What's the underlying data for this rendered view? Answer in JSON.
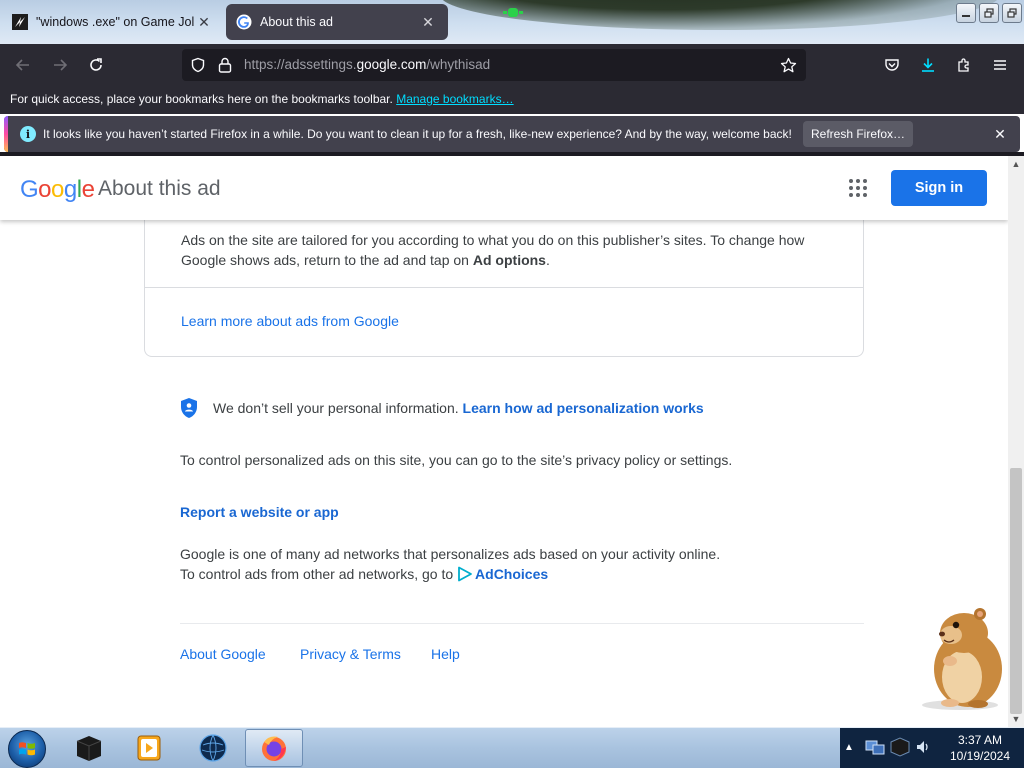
{
  "browser": {
    "tabs": [
      {
        "title": "\"windows .exe\" on Game Jolt",
        "active": false
      },
      {
        "title": "About this ad",
        "active": true
      }
    ],
    "url_prefix": "https://adssettings.",
    "url_domain": "google.com",
    "url_path": "/whythisad",
    "bookmarks_text": "For quick access, place your bookmarks here on the bookmarks toolbar.",
    "bookmarks_link": "Manage bookmarks…",
    "notification": {
      "message": "It looks like you haven’t started Firefox in a while. Do you want to clean it up for a fresh, like-new experience? And by the way, welcome back!",
      "button": "Refresh Firefox…"
    },
    "colors": {
      "chrome_dark": "#2b2a33",
      "url_bg": "#1c1b22",
      "accent_link": "#00ddff"
    }
  },
  "header": {
    "logo_text": "Google",
    "title": "About this ad",
    "signin": "Sign in"
  },
  "card": {
    "text_before": "Ads on the site are tailored for you according to what you do on this publisher’s sites. To change how Google shows ads, return to the ad and tap on ",
    "text_bold": "Ad options",
    "text_after": ".",
    "learn_more": "Learn more about ads from Google"
  },
  "content": {
    "privacy_text": "We don’t sell your personal information.",
    "privacy_link": "Learn how ad personalization works",
    "control_text": "To control personalized ads on this site, you can go to the site’s privacy policy or settings.",
    "report_link": "Report a website or app",
    "networks_line1": "Google is one of many ad networks that personalizes ads based on your activity online.",
    "networks_line2": "To control ads from other ad networks, go to",
    "adchoices": "AdChoices"
  },
  "footer": {
    "links": [
      "About Google",
      "Privacy & Terms",
      "Help"
    ]
  },
  "taskbar": {
    "time": "3:37 AM",
    "date": "10/19/2024",
    "apps": [
      "black-cube-app-icon",
      "media-player-icon",
      "globe-app-icon",
      "firefox-icon"
    ]
  }
}
